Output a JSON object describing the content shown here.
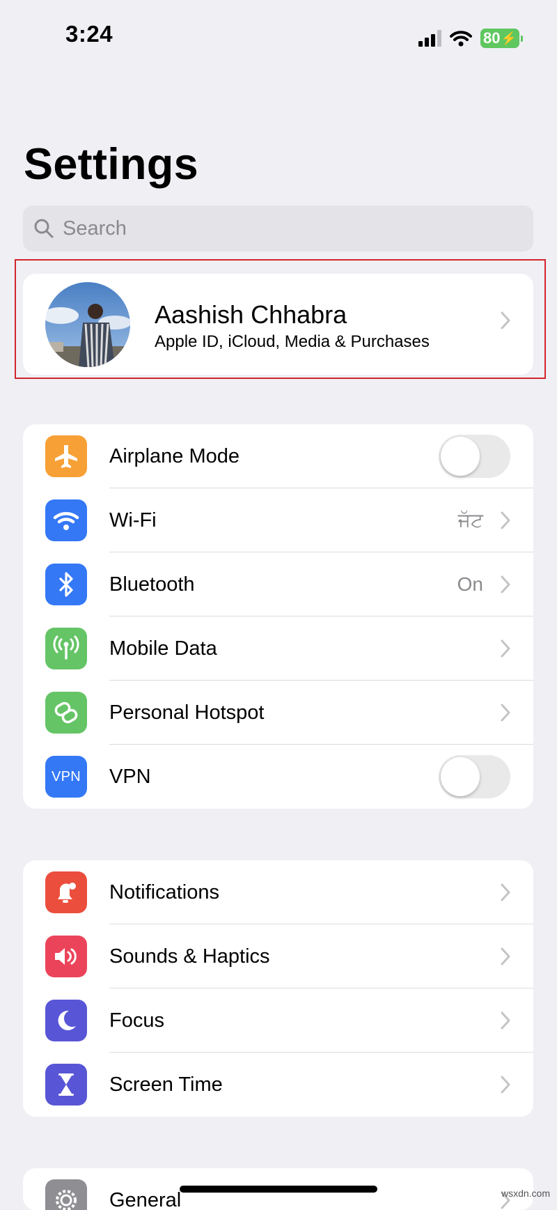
{
  "status_bar": {
    "time": "3:24",
    "battery": "80"
  },
  "page": {
    "title": "Settings"
  },
  "search": {
    "placeholder": "Search"
  },
  "profile": {
    "name": "Aashish Chhabra",
    "subtitle": "Apple ID, iCloud, Media & Purchases"
  },
  "groups": [
    {
      "rows": [
        {
          "label": "Airplane Mode",
          "icon": "airplane-icon",
          "color": "#f7a035",
          "control": "toggle",
          "on": false
        },
        {
          "label": "Wi-Fi",
          "icon": "wifi-icon",
          "color": "#3478f6",
          "value": "ਜੱਟ"
        },
        {
          "label": "Bluetooth",
          "icon": "bluetooth-icon",
          "color": "#3478f6",
          "value": "On"
        },
        {
          "label": "Mobile Data",
          "icon": "antenna-icon",
          "color": "#65c466"
        },
        {
          "label": "Personal Hotspot",
          "icon": "hotspot-icon",
          "color": "#65c466"
        },
        {
          "label": "VPN",
          "icon": "vpn-icon",
          "color": "#3478f6",
          "icon_text": "VPN",
          "control": "toggle",
          "on": false
        }
      ]
    },
    {
      "rows": [
        {
          "label": "Notifications",
          "icon": "bell-icon",
          "color": "#eb4e3d"
        },
        {
          "label": "Sounds & Haptics",
          "icon": "speaker-icon",
          "color": "#eb445a"
        },
        {
          "label": "Focus",
          "icon": "moon-icon",
          "color": "#5856d6"
        },
        {
          "label": "Screen Time",
          "icon": "hourglass-icon",
          "color": "#5856d6"
        }
      ]
    },
    {
      "rows": [
        {
          "label": "General",
          "icon": "gear-icon",
          "color": "#8e8e93"
        }
      ]
    }
  ],
  "watermark": "wsxdn.com"
}
